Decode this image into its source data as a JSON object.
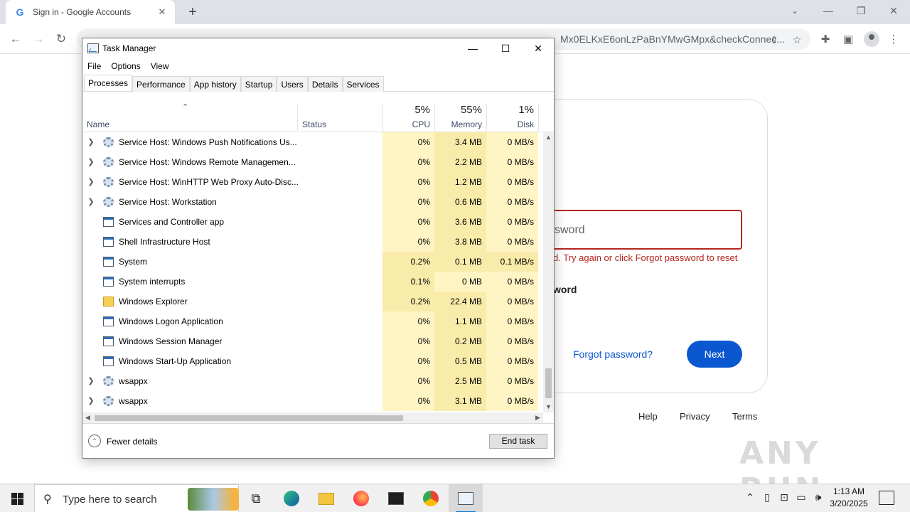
{
  "browser": {
    "tab_title": "Sign in - Google Accounts",
    "favicon": "G",
    "url_visible": "Mx0ELKxE6onLzPaBnYMwGMpx&checkConnec...",
    "icons": [
      "back-icon",
      "forward-icon",
      "reload-icon",
      "share-icon",
      "star-icon",
      "extensions-icon",
      "side-panel-icon",
      "profile-icon",
      "more-icon"
    ]
  },
  "signin": {
    "password_placeholder": "sword",
    "error_text": "d. Try again or click Forgot password to reset",
    "show_password_label": "word",
    "forgot_link": "Forgot password?",
    "next_button": "Next",
    "footer": [
      "Help",
      "Privacy",
      "Terms"
    ],
    "error_color": "#b3261e",
    "accent_color": "#0b57d0"
  },
  "watermark": "ANY RUN",
  "task_manager": {
    "title": "Task Manager",
    "menu": [
      "File",
      "Options",
      "View"
    ],
    "tabs": [
      "Processes",
      "Performance",
      "App history",
      "Startup",
      "Users",
      "Details",
      "Services"
    ],
    "active_tab": "Processes",
    "columns": {
      "name": "Name",
      "status": "Status",
      "cpu": {
        "pct": "5%",
        "label": "CPU"
      },
      "memory": {
        "pct": "55%",
        "label": "Memory"
      },
      "disk": {
        "pct": "1%",
        "label": "Disk"
      }
    },
    "rows": [
      {
        "name": "Service Host: Windows Push Notifications Us...",
        "status": "",
        "cpu": "0%",
        "memory": "3.4 MB",
        "disk": "0 MB/s",
        "expandable": true,
        "icon": "gear-icon"
      },
      {
        "name": "Service Host: Windows Remote Managemen...",
        "status": "",
        "cpu": "0%",
        "memory": "2.2 MB",
        "disk": "0 MB/s",
        "expandable": true,
        "icon": "gear-icon"
      },
      {
        "name": "Service Host: WinHTTP Web Proxy Auto-Disc...",
        "status": "",
        "cpu": "0%",
        "memory": "1.2 MB",
        "disk": "0 MB/s",
        "expandable": true,
        "icon": "gear-icon"
      },
      {
        "name": "Service Host: Workstation",
        "status": "",
        "cpu": "0%",
        "memory": "0.6 MB",
        "disk": "0 MB/s",
        "expandable": true,
        "icon": "gear-icon"
      },
      {
        "name": "Services and Controller app",
        "status": "",
        "cpu": "0%",
        "memory": "3.6 MB",
        "disk": "0 MB/s",
        "expandable": false,
        "icon": "app-icon"
      },
      {
        "name": "Shell Infrastructure Host",
        "status": "",
        "cpu": "0%",
        "memory": "3.8 MB",
        "disk": "0 MB/s",
        "expandable": false,
        "icon": "app-icon"
      },
      {
        "name": "System",
        "status": "",
        "cpu": "0.2%",
        "memory": "0.1 MB",
        "disk": "0.1 MB/s",
        "expandable": false,
        "icon": "app-icon"
      },
      {
        "name": "System interrupts",
        "status": "",
        "cpu": "0.1%",
        "memory": "0 MB",
        "disk": "0 MB/s",
        "expandable": false,
        "icon": "app-icon"
      },
      {
        "name": "Windows Explorer",
        "status": "",
        "cpu": "0.2%",
        "memory": "22.4 MB",
        "disk": "0 MB/s",
        "expandable": false,
        "icon": "folder-icon"
      },
      {
        "name": "Windows Logon Application",
        "status": "",
        "cpu": "0%",
        "memory": "1.1 MB",
        "disk": "0 MB/s",
        "expandable": false,
        "icon": "app-icon"
      },
      {
        "name": "Windows Session Manager",
        "status": "",
        "cpu": "0%",
        "memory": "0.2 MB",
        "disk": "0 MB/s",
        "expandable": false,
        "icon": "app-icon"
      },
      {
        "name": "Windows Start-Up Application",
        "status": "",
        "cpu": "0%",
        "memory": "0.5 MB",
        "disk": "0 MB/s",
        "expandable": false,
        "icon": "app-icon"
      },
      {
        "name": "wsappx",
        "status": "",
        "cpu": "0%",
        "memory": "2.5 MB",
        "disk": "0 MB/s",
        "expandable": true,
        "icon": "gear-icon"
      },
      {
        "name": "wsappx",
        "status": "",
        "cpu": "0%",
        "memory": "3.1 MB",
        "disk": "0 MB/s",
        "expandable": true,
        "icon": "gear-icon"
      }
    ],
    "fewer_details": "Fewer details",
    "end_task": "End task"
  },
  "taskbar": {
    "search_placeholder": "Type here to search",
    "apps": [
      "task-view-icon",
      "edge-icon",
      "file-explorer-icon",
      "firefox-icon",
      "terminal-icon",
      "chrome-icon",
      "task-manager-icon"
    ],
    "time": "1:13 AM",
    "date": "3/20/2025"
  }
}
